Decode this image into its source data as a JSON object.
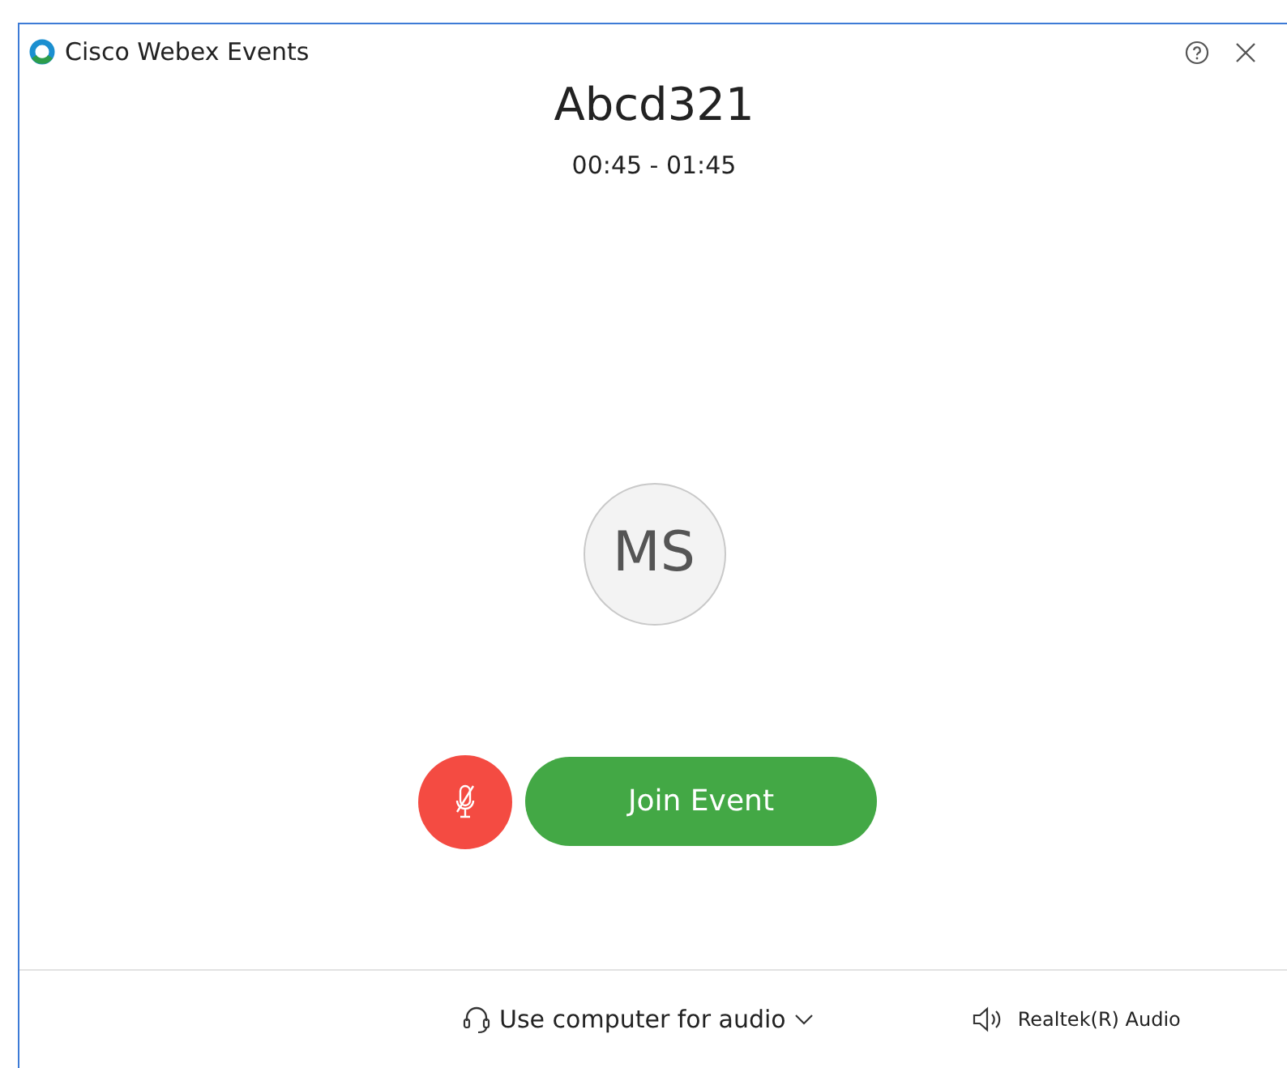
{
  "window": {
    "title": "Cisco Webex Events"
  },
  "meeting": {
    "title": "Abcd321",
    "time": "00:45 - 01:45"
  },
  "avatar": {
    "initials": "MS"
  },
  "mute_button": {
    "muted": true
  },
  "join_button": {
    "label": "Join Event"
  },
  "footer": {
    "audio_option": "Use computer for audio",
    "speaker": "Realtek(R) Audio"
  }
}
